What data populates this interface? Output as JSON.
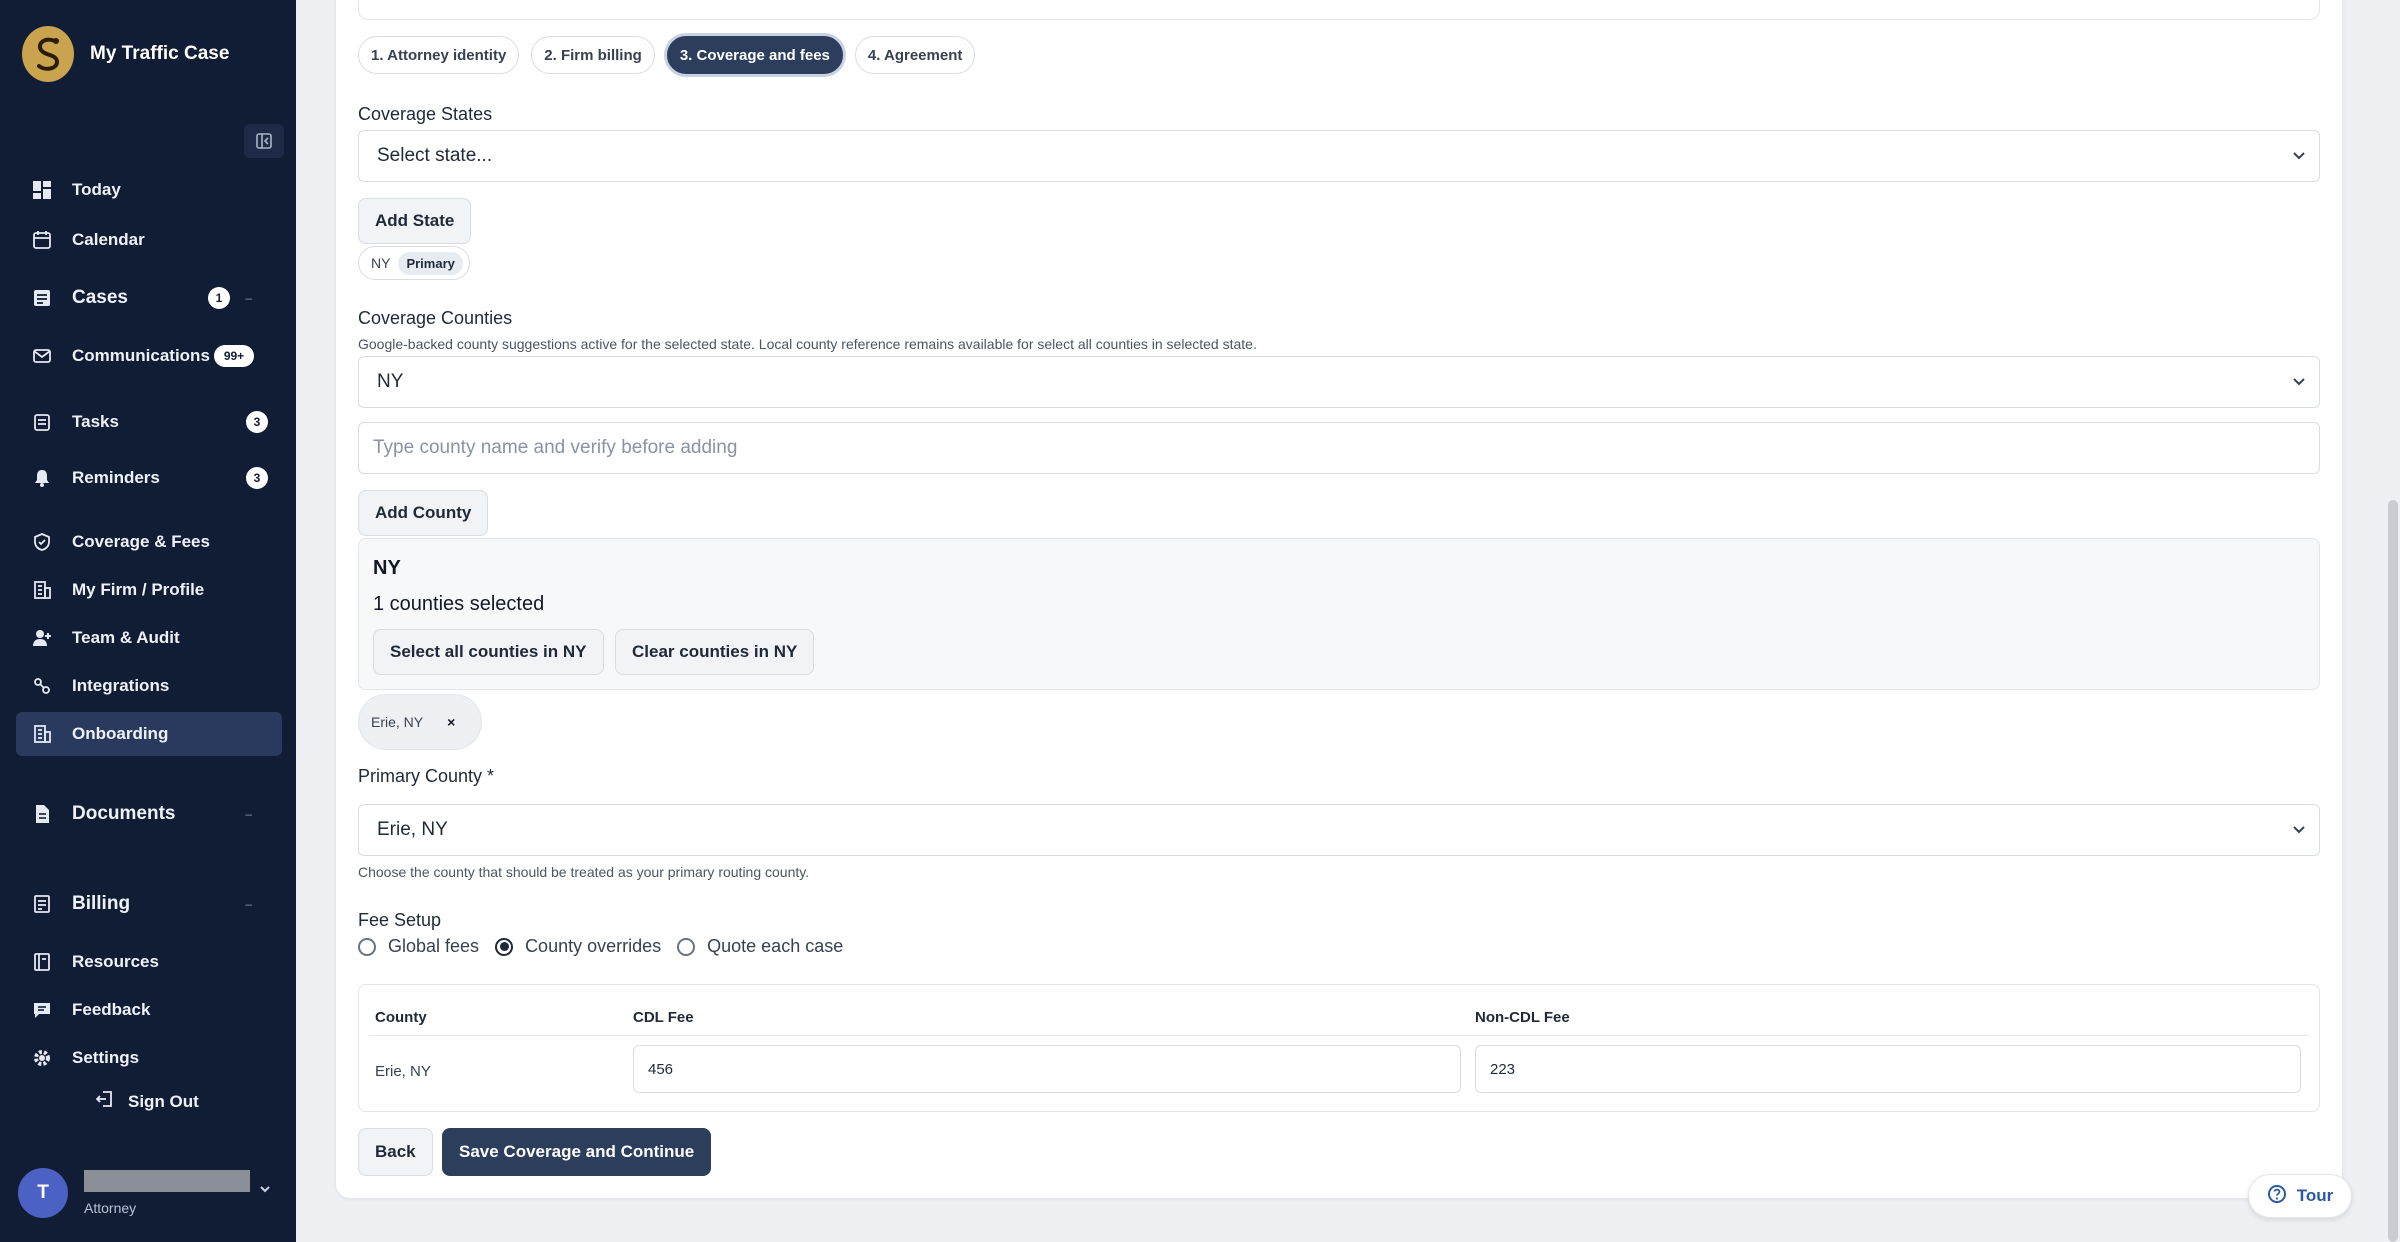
{
  "app": {
    "name": "My Traffic Case"
  },
  "sidebar": {
    "items": [
      {
        "label": "Today",
        "icon": "dashboard-icon"
      },
      {
        "label": "Calendar",
        "icon": "calendar-icon"
      },
      {
        "label": "Cases",
        "icon": "document-list-icon",
        "badge": "1"
      },
      {
        "label": "Communications",
        "icon": "mail-icon",
        "badge": "99+"
      },
      {
        "label": "Tasks",
        "icon": "clipboard-icon",
        "badge": "3"
      },
      {
        "label": "Reminders",
        "icon": "bell-icon",
        "badge": "3"
      },
      {
        "label": "Coverage & Fees",
        "icon": "shield-icon"
      },
      {
        "label": "My Firm / Profile",
        "icon": "building-icon"
      },
      {
        "label": "Team & Audit",
        "icon": "user-plus-icon"
      },
      {
        "label": "Integrations",
        "icon": "link-icon"
      },
      {
        "label": "Onboarding",
        "icon": "building-icon",
        "active": true
      },
      {
        "label": "Documents",
        "icon": "file-icon"
      },
      {
        "label": "Billing",
        "icon": "receipt-icon"
      },
      {
        "label": "Resources",
        "icon": "book-icon"
      },
      {
        "label": "Feedback",
        "icon": "chat-icon"
      },
      {
        "label": "Settings",
        "icon": "gear-icon"
      }
    ],
    "sign_out": "Sign Out",
    "user": {
      "initial": "T",
      "role": "Attorney"
    }
  },
  "steps": [
    {
      "label": "1. Attorney identity"
    },
    {
      "label": "2. Firm billing"
    },
    {
      "label": "3. Coverage and fees",
      "active": true
    },
    {
      "label": "4. Agreement"
    }
  ],
  "coverage_states": {
    "label": "Coverage States",
    "select_value": "Select state...",
    "add_button": "Add State",
    "chip_code": "NY",
    "chip_tag": "Primary"
  },
  "coverage_counties": {
    "label": "Coverage Counties",
    "help": "Google-backed county suggestions active for the selected state. Local county reference remains available for select all counties in selected state.",
    "state_select_value": "NY",
    "county_placeholder": "Type county name and verify before adding",
    "add_button": "Add County",
    "panel_title": "NY",
    "panel_count": "1 counties selected",
    "select_all_button": "Select all counties in NY",
    "clear_button": "Clear counties in NY",
    "chip": "Erie, NY",
    "chip_remove": "×"
  },
  "primary_county": {
    "label": "Primary County *",
    "value": "Erie, NY",
    "help": "Choose the county that should be treated as your primary routing county."
  },
  "fee_setup": {
    "label": "Fee Setup",
    "options": [
      "Global fees",
      "County overrides",
      "Quote each case"
    ],
    "selected": "County overrides",
    "table": {
      "headers": [
        "County",
        "CDL Fee",
        "Non-CDL Fee"
      ],
      "rows": [
        {
          "county": "Erie, NY",
          "cdl": "456",
          "non_cdl": "223"
        }
      ]
    }
  },
  "actions": {
    "back": "Back",
    "save": "Save Coverage and Continue"
  },
  "tour": {
    "label": "Tour"
  },
  "colors": {
    "sidebar_bg": "#111d35",
    "active_step": "#2c3e5c",
    "brand_gold": "#c9a34e"
  }
}
